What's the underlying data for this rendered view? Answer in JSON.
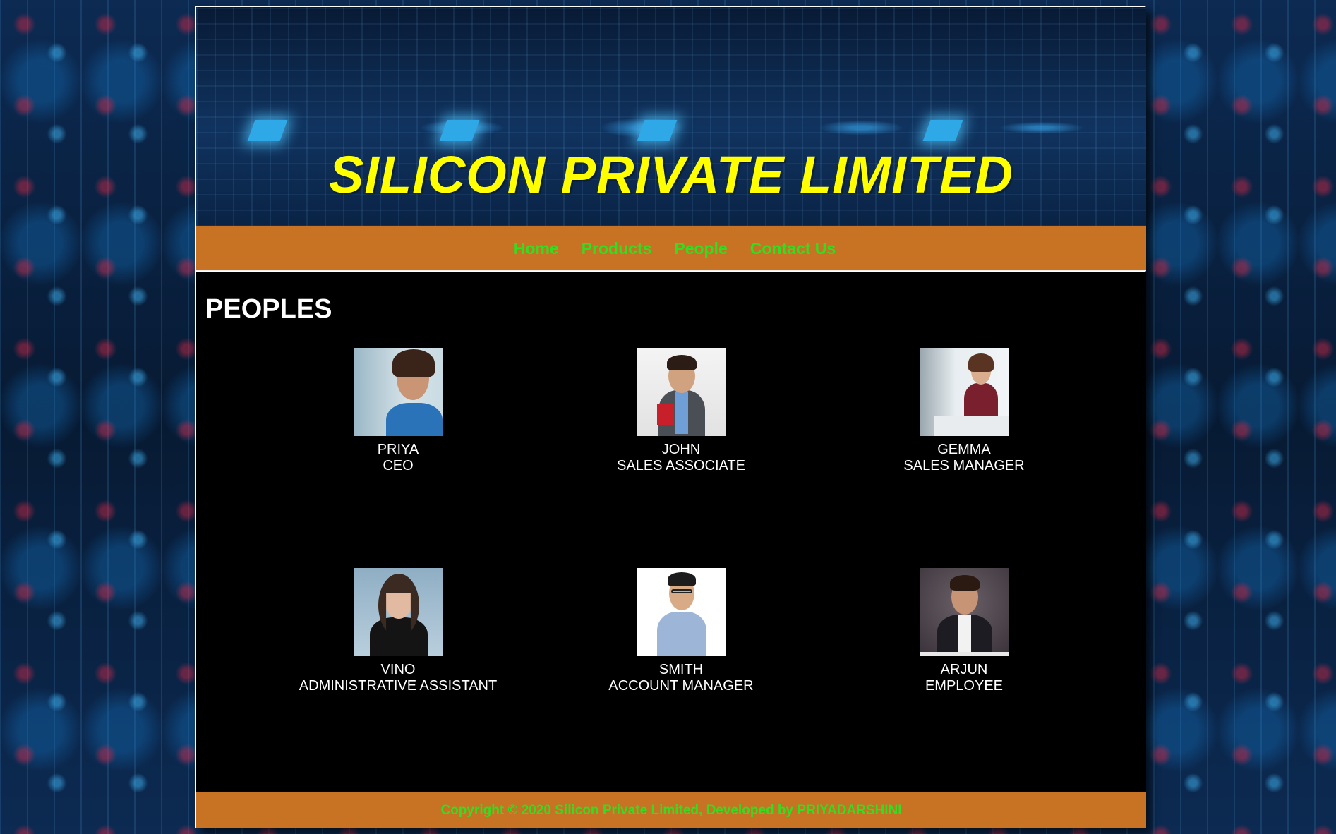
{
  "banner": {
    "title": "SILICON PRIVATE LIMITED"
  },
  "nav": {
    "items": [
      {
        "label": "Home"
      },
      {
        "label": "Products"
      },
      {
        "label": "People"
      },
      {
        "label": "Contact Us"
      }
    ]
  },
  "main": {
    "heading": "PEOPLES",
    "people": [
      {
        "name": "PRIYA",
        "role": "CEO"
      },
      {
        "name": "JOHN",
        "role": "SALES ASSOCIATE"
      },
      {
        "name": "GEMMA",
        "role": "SALES MANAGER"
      },
      {
        "name": "VINO",
        "role": "ADMINISTRATIVE ASSISTANT"
      },
      {
        "name": "SMITH",
        "role": "ACCOUNT MANAGER"
      },
      {
        "name": "ARJUN",
        "role": "EMPLOYEE"
      }
    ]
  },
  "footer": {
    "text": "Copyright © 2020 Silicon Private Limited, Developed by PRIYADARSHINI"
  },
  "colors": {
    "banner_title": "#ffff00",
    "nav_bg": "#c87223",
    "nav_link": "#33dd22",
    "content_bg": "#000000"
  }
}
